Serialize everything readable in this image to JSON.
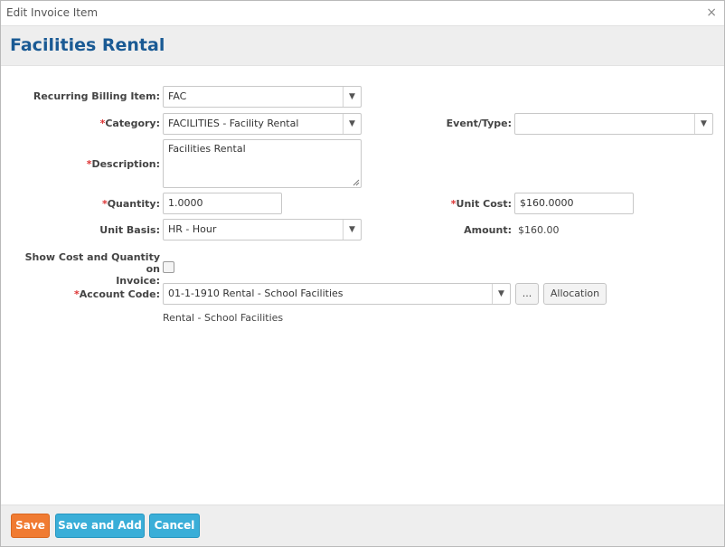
{
  "dialog": {
    "title": "Edit Invoice Item",
    "close_glyph": "×",
    "heading": "Facilities Rental"
  },
  "form": {
    "required_marker": "*",
    "recurring_billing_item": {
      "label": "Recurring Billing Item:",
      "value": "FAC"
    },
    "category": {
      "label": "Category:",
      "value": "FACILITIES - Facility Rental"
    },
    "event_type": {
      "label": "Event/Type:",
      "value": ""
    },
    "description": {
      "label": "Description:",
      "value": "Facilities Rental"
    },
    "quantity": {
      "label": "Quantity:",
      "value": "1.0000"
    },
    "unit_cost": {
      "label": "Unit Cost:",
      "value": "$160.0000"
    },
    "unit_basis": {
      "label": "Unit Basis:",
      "value": "HR - Hour"
    },
    "amount": {
      "label": "Amount:",
      "value": "$160.00"
    },
    "show_cost_quantity": {
      "label_line1": "Show Cost and Quantity on",
      "label_line2": "Invoice:",
      "checked": false
    },
    "account_code": {
      "label": "Account Code:",
      "value": "01-1-1910 Rental - School Facilities",
      "lookup_label": "...",
      "allocation_label": "Allocation",
      "description": "Rental - School Facilities"
    },
    "dropdown_glyph": "▼"
  },
  "footer": {
    "save_label": "Save",
    "save_and_add_label": "Save and Add",
    "cancel_label": "Cancel"
  },
  "colors": {
    "heading": "#1a5a94",
    "save_button": "#f07b32",
    "secondary_buttons": "#3aaed8",
    "required": "#dd3333"
  },
  "icons": {
    "close": "close-icon",
    "dropdown": "chevron-down-icon"
  }
}
